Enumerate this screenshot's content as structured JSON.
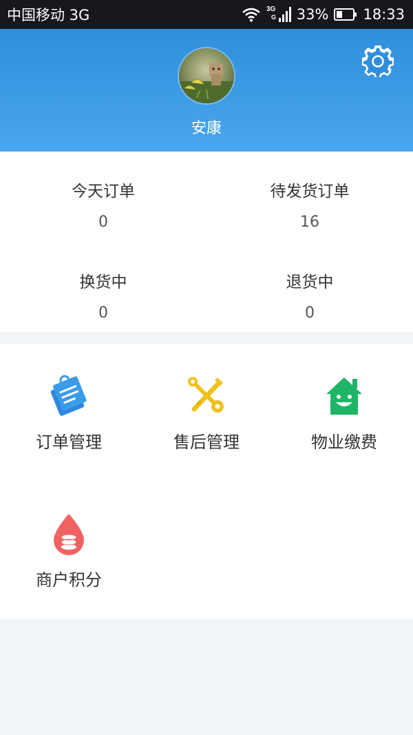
{
  "status_bar": {
    "carrier": "中国移动 3G",
    "battery": "33%",
    "time": "18:33",
    "network_label": "3G"
  },
  "profile": {
    "username": "安康",
    "avatar_icon": "avatar-photo",
    "settings_icon": "gear-icon"
  },
  "stats": [
    {
      "label": "今天订单",
      "value": "0"
    },
    {
      "label": "待发货订单",
      "value": "16"
    },
    {
      "label": "换货中",
      "value": "0"
    },
    {
      "label": "退货中",
      "value": "0"
    }
  ],
  "menu": [
    {
      "label": "订单管理",
      "icon": "order-notes-icon",
      "color": "#3a9be8"
    },
    {
      "label": "售后管理",
      "icon": "tools-icon",
      "color": "#f0c11e"
    },
    {
      "label": "物业缴费",
      "icon": "smiling-house-icon",
      "color": "#1fb567"
    },
    {
      "label": "商户积分",
      "icon": "coin-drop-icon",
      "color": "#f06262"
    }
  ],
  "colors": {
    "header_top": "#2f8fdc",
    "header_bottom": "#4aa6ec",
    "status_bar": "#16181c",
    "page_background": "#f2f5f7"
  }
}
